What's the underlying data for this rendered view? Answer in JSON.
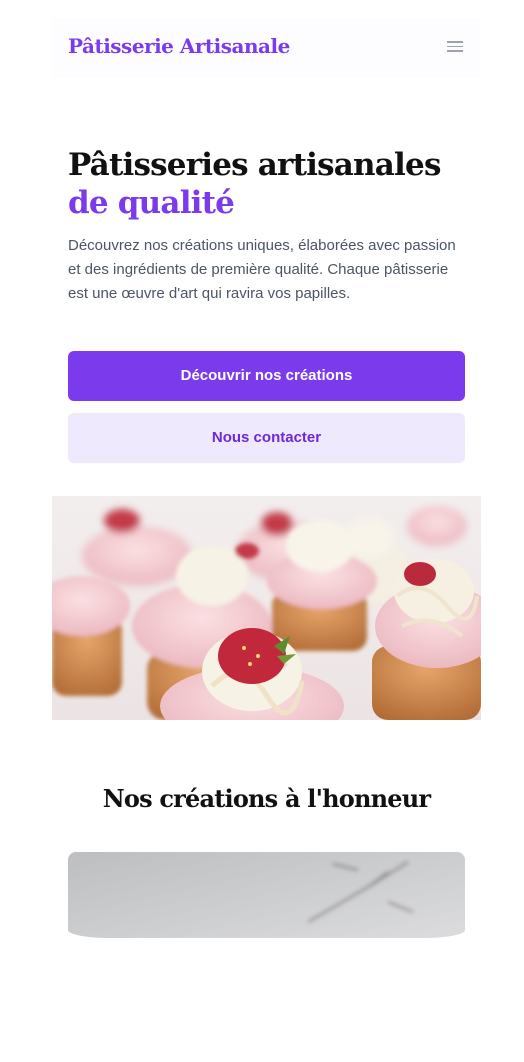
{
  "header": {
    "brand": "Pâtisserie Artisanale",
    "menu_icon": "hamburger-menu-icon"
  },
  "hero": {
    "title_line1": "Pâtisseries artisanales",
    "title_line2": "de qualité",
    "description": "Découvrez nos créations uniques, élaborées avec passion et des ingrédients de première qualité. Chaque pâtisserie est une œuvre d'art qui ravira vos papilles.",
    "primary_button": "Découvrir nos créations",
    "secondary_button": "Nous contacter"
  },
  "featured": {
    "title": "Nos créations à l'honneur"
  },
  "colors": {
    "accent": "#7c3aed",
    "accent_light": "#efe9fe",
    "text_dark": "#111111",
    "text_muted": "#4b5563"
  }
}
